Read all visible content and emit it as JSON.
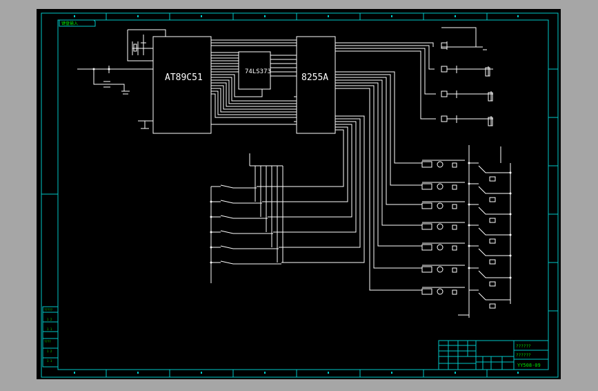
{
  "drawing": {
    "tag_label": "键盘输入",
    "chips": {
      "mcu": "AT89C51",
      "latch": "74LS373",
      "ppi": "8255A"
    },
    "title_block": {
      "row1": "??????",
      "row2": "??????",
      "code": "YY508-09"
    },
    "left_table_rows": [
      "?????",
      "1 2",
      "1 1",
      "????",
      "1 2",
      "1 1"
    ]
  },
  "colors": {
    "background": "#a6a6a6",
    "sheet": "#000000",
    "frame": "#00c8c8",
    "wire": "#ffffff",
    "title_text": "#00e600"
  }
}
